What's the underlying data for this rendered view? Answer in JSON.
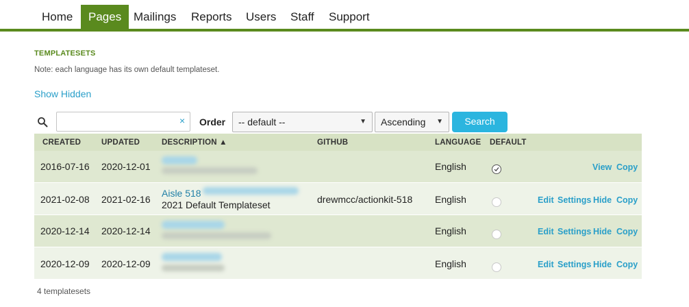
{
  "nav": {
    "items": [
      {
        "label": "Home"
      },
      {
        "label": "Pages"
      },
      {
        "label": "Mailings"
      },
      {
        "label": "Reports"
      },
      {
        "label": "Users"
      },
      {
        "label": "Staff"
      },
      {
        "label": "Support"
      }
    ],
    "active": "Pages"
  },
  "page": {
    "section_title": "TEMPLATESETS",
    "note": "Note: each language has its own default templateset.",
    "show_hidden": "Show Hidden"
  },
  "search": {
    "value": "",
    "clear_symbol": "×",
    "order_label": "Order",
    "order_value": "-- default --",
    "direction_value": "Ascending",
    "button_label": "Search"
  },
  "table": {
    "headers": {
      "created": "CREATED",
      "updated": "UPDATED",
      "description": "DESCRIPTION ▲",
      "github": "GITHUB",
      "language": "LANGUAGE",
      "default": "DEFAULT"
    },
    "rows": [
      {
        "created": "2016-07-16",
        "updated": "2020-12-01",
        "name": "",
        "description": "",
        "github": "",
        "language": "English",
        "is_default": true,
        "actions": [
          "View",
          "Copy"
        ]
      },
      {
        "created": "2021-02-08",
        "updated": "2021-02-16",
        "name": "Aisle 518",
        "description": "2021 Default Templateset",
        "github": "drewmcc/actionkit-518",
        "language": "English",
        "is_default": false,
        "actions": [
          "Edit",
          "Settings",
          "Hide",
          "Copy"
        ]
      },
      {
        "created": "2020-12-14",
        "updated": "2020-12-14",
        "name": "",
        "description": "",
        "github": "",
        "language": "English",
        "is_default": false,
        "actions": [
          "Edit",
          "Settings",
          "Hide",
          "Copy"
        ]
      },
      {
        "created": "2020-12-09",
        "updated": "2020-12-09",
        "name": "",
        "description": "",
        "github": "",
        "language": "English",
        "is_default": false,
        "actions": [
          "Edit",
          "Settings",
          "Hide",
          "Copy"
        ]
      }
    ]
  },
  "footer": {
    "count_text": "4 templatesets"
  },
  "colors": {
    "brand_green": "#5a8a1e",
    "link_blue": "#2a9fc9",
    "button_blue": "#2bb5df",
    "header_row": "#d7e2c4",
    "row_shade": "#dfe8d1",
    "row_light": "#eef3e8"
  }
}
